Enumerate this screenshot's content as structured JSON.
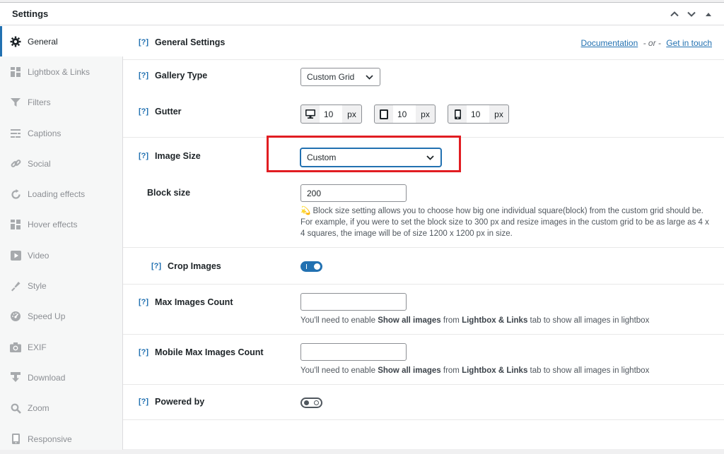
{
  "panel": {
    "title": "Settings"
  },
  "sidebar": {
    "items": [
      {
        "label": "General",
        "icon": "gear-icon",
        "active": true
      },
      {
        "label": "Lightbox & Links",
        "icon": "grid-icon"
      },
      {
        "label": "Filters",
        "icon": "filter-icon"
      },
      {
        "label": "Captions",
        "icon": "captions-icon"
      },
      {
        "label": "Social",
        "icon": "link-icon"
      },
      {
        "label": "Loading effects",
        "icon": "refresh-icon"
      },
      {
        "label": "Hover effects",
        "icon": "grid-icon"
      },
      {
        "label": "Video",
        "icon": "video-icon"
      },
      {
        "label": "Style",
        "icon": "brush-icon"
      },
      {
        "label": "Speed Up",
        "icon": "dashboard-icon"
      },
      {
        "label": "EXIF",
        "icon": "camera-icon"
      },
      {
        "label": "Download",
        "icon": "download-icon"
      },
      {
        "label": "Zoom",
        "icon": "search-icon"
      },
      {
        "label": "Responsive",
        "icon": "mobile-icon"
      }
    ]
  },
  "help_label": "[?]",
  "general": {
    "title": "General Settings",
    "documentation_link": "Documentation",
    "or_text": "- or -",
    "contact_link": "Get in touch"
  },
  "gallery_type": {
    "label": "Gallery Type",
    "value": "Custom Grid"
  },
  "gutter": {
    "label": "Gutter",
    "desktop": "10",
    "tablet": "10",
    "mobile": "10",
    "unit": "px"
  },
  "image_size": {
    "label": "Image Size",
    "value": "Custom"
  },
  "block_size": {
    "label": "Block size",
    "value": "200",
    "description": "💫 Block size setting allows you to choose how big one individual square(block) from the custom grid should be. For example, if you were to set the block size to 300 px and resize images in the custom grid to be as large as 4 x 4 squares, the image will be of size 1200 x 1200 px in size."
  },
  "crop_images": {
    "label": "Crop Images",
    "enabled": true
  },
  "max_images": {
    "label": "Max Images Count",
    "value": "",
    "desc_prefix": "You'll need to enable ",
    "desc_bold1": "Show all images",
    "desc_mid": " from ",
    "desc_bold2": "Lightbox & Links",
    "desc_suffix": " tab to show all images in lightbox"
  },
  "mobile_max_images": {
    "label": "Mobile Max Images Count",
    "value": "",
    "desc_prefix": "You'll need to enable ",
    "desc_bold1": "Show all images",
    "desc_mid": " from ",
    "desc_bold2": "Lightbox & Links",
    "desc_suffix": " tab to show all images in lightbox"
  },
  "powered_by": {
    "label": "Powered by",
    "enabled": false
  },
  "colors": {
    "accent": "#2271b1",
    "highlight": "#e11d22"
  }
}
